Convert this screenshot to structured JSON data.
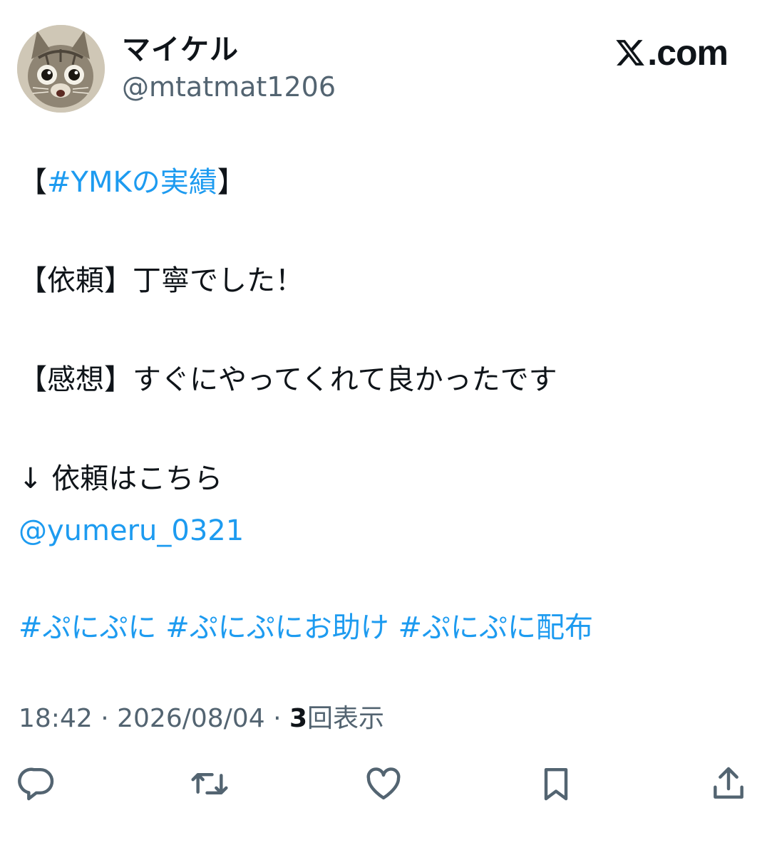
{
  "author": {
    "display_name": "マイケル",
    "handle": "@mtatmat1206"
  },
  "brand": {
    "text": ".com",
    "icon": "x-logo-icon"
  },
  "tweet": {
    "line1": {
      "open": "【",
      "hashtag": "#YMKの実績",
      "close": "】"
    },
    "line2": "【依頼】丁寧でした！",
    "line3": "【感想】すぐにやってくれて良かったです",
    "line4": "↓ 依頼はこちら",
    "mention": "@yumeru_0321",
    "hashtags": [
      "#ぷにぷに",
      "#ぷにぷにお助け",
      "#ぷにぷに配布"
    ]
  },
  "meta": {
    "time": "18:42",
    "date": "2026/08/04",
    "separator": "·",
    "view_count": "3",
    "view_label": "回表示"
  },
  "actions": [
    {
      "name": "reply",
      "icon": "reply-icon"
    },
    {
      "name": "retweet",
      "icon": "retweet-icon"
    },
    {
      "name": "like",
      "icon": "heart-icon"
    },
    {
      "name": "bookmark",
      "icon": "bookmark-icon"
    },
    {
      "name": "share",
      "icon": "share-icon"
    }
  ],
  "colors": {
    "link": "#1d9bf0",
    "text": "#0f1419",
    "secondary": "#536471"
  }
}
